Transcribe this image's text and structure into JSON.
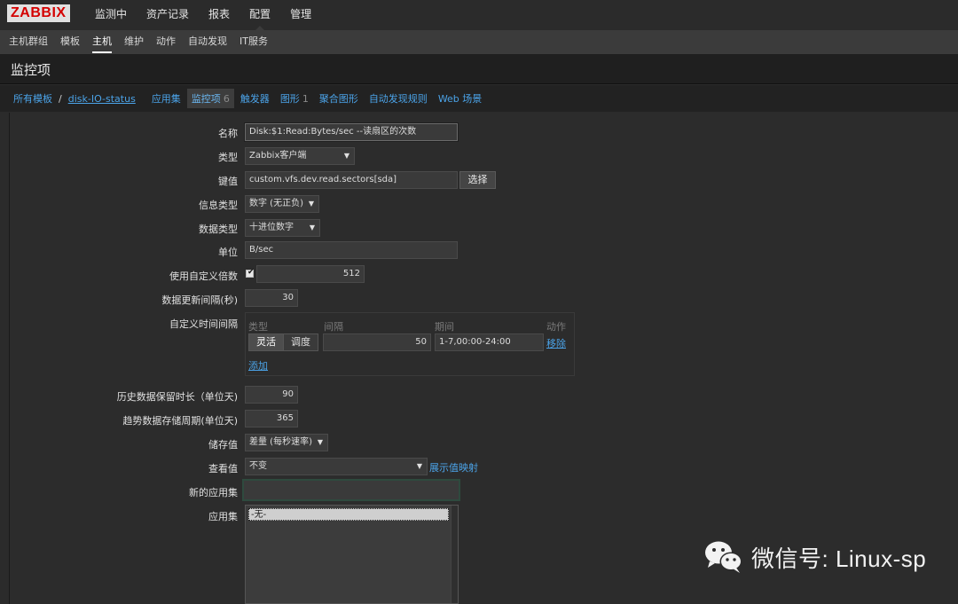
{
  "logo": "ZABBIX",
  "top_menu": [
    "监测中",
    "资产记录",
    "报表",
    "配置",
    "管理"
  ],
  "sub_menu": [
    "主机群组",
    "模板",
    "主机",
    "维护",
    "动作",
    "自动发现",
    "IT服务"
  ],
  "page_title": "监控项",
  "breadcrumb": {
    "all_templates": "所有模板",
    "separator": "/",
    "template": "disk-IO-status",
    "applications": "应用集",
    "items": "监控项",
    "items_count": "6",
    "triggers": "触发器",
    "graphs": "图形",
    "graphs_count": "1",
    "screens": "聚合图形",
    "discovery": "自动发现规则",
    "web": "Web 场景"
  },
  "form": {
    "name_label": "名称",
    "name_value": "Disk:$1:Read:Bytes/sec --读扇区的次数",
    "type_label": "类型",
    "type_value": "Zabbix客户端",
    "key_label": "键值",
    "key_value": "custom.vfs.dev.read.sectors[sda]",
    "select_button": "选择",
    "info_type_label": "信息类型",
    "info_type_value": "数字 (无正负)",
    "data_type_label": "数据类型",
    "data_type_value": "十进位数字",
    "units_label": "单位",
    "units_value": "B/sec",
    "multiplier_label": "使用自定义倍数",
    "multiplier_checked": true,
    "multiplier_value": "512",
    "interval_label": "数据更新间隔(秒)",
    "interval_value": "30",
    "custom_intervals_label": "自定义时间间隔",
    "ci_header_type": "类型",
    "ci_header_interval": "间隔",
    "ci_header_period": "期间",
    "ci_header_action": "动作",
    "ci_flexible": "灵活",
    "ci_scheduling": "调度",
    "ci_interval_value": "50",
    "ci_period_value": "1-7,00:00-24:00",
    "ci_remove": "移除",
    "ci_add": "添加",
    "history_label": "历史数据保留时长（单位天)",
    "history_value": "90",
    "trends_label": "趋势数据存储周期(单位天)",
    "trends_value": "365",
    "store_value_label": "储存值",
    "store_value": "差量 (每秒速率)",
    "show_value_label": "查看值",
    "show_value": "不变",
    "show_value_mapping": "展示值映射",
    "new_app_label": "新的应用集",
    "new_app_value": "",
    "apps_label": "应用集",
    "apps_option": "-无-"
  },
  "watermark": "微信号: Linux-sp"
}
